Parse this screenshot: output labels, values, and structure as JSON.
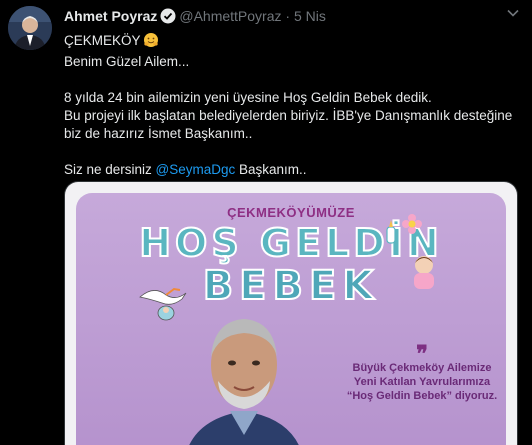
{
  "tweet": {
    "author_name": "Ahmet Poyraz",
    "handle": "@AhmettPoyraz",
    "separator": "·",
    "time": "5 Nis",
    "lines": {
      "line1": "ÇEKMEKÖY",
      "line2": "Benim Güzel Ailem...",
      "line3": "8 yılda 24 bin ailemizin yeni üyesine Hoş Geldin Bebek dedik.",
      "line4": "Bu projeyi ilk başlatan belediyelerden biriyiz. İBB'ye Danışmanlık desteğine",
      "line5": "biz de hazırız İsmet Başkanım..",
      "line6_prefix": "Siz ne dersiniz ",
      "line6_mention": "@SeymaDgc",
      "line6_suffix": " Başkanım.."
    }
  },
  "poster": {
    "subtitle": "ÇEKMEKÖYÜMÜZE",
    "title_line1": "HOŞ GELDİN",
    "title_line2": "BEBEK",
    "quote_mark": "❞",
    "quote_line1": "Büyük Çekmeköy Ailemize",
    "quote_line2": "Yeni Katılan Yavrularımıza",
    "quote_line3": "“Hoş Geldin Bebek” diyoruz."
  },
  "icons": {
    "verified": "verified-badge-icon",
    "caret": "chevron-down-icon",
    "emoji": "hugging-face-emoji"
  },
  "colors": {
    "background": "#000000",
    "text": "#e7e9ea",
    "secondary_text": "#71767b",
    "mention": "#1d9bf0",
    "poster_purple": "#b592cd",
    "poster_title": "#5ab6c0"
  }
}
